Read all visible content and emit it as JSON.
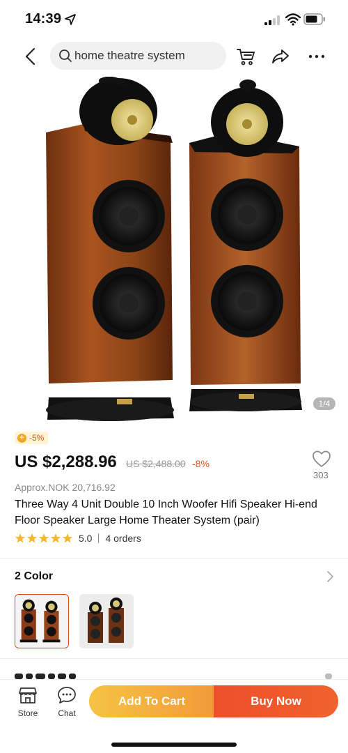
{
  "status_bar": {
    "time": "14:39"
  },
  "nav": {
    "search_text": "home theatre system",
    "icons": [
      "back-chevron-icon",
      "search-icon",
      "cart-icon",
      "share-icon",
      "more-icon"
    ]
  },
  "gallery": {
    "counter": "1/4"
  },
  "price_block": {
    "discount_tag": "-5%",
    "price": "US $2,288.96",
    "original_price": "US $2,488.00",
    "percent_off": "-8%",
    "approx": "Approx.NOK 20,716.92",
    "wishlist_count": "303"
  },
  "product": {
    "title": "Three Way 4 Unit Double 10 Inch Woofer Hifi Speaker Hi-end Floor Speaker Large Home Theater System (pair)",
    "rating": "5.0",
    "stars": 5,
    "orders": "4 orders"
  },
  "color_section": {
    "title": "2 Color",
    "selected_index": 0
  },
  "bottom_bar": {
    "store_label": "Store",
    "chat_label": "Chat",
    "add_to_cart": "Add To Cart",
    "buy_now": "Buy Now"
  },
  "colors": {
    "accent": "#e0541e",
    "add_cart_gradient": [
      "#f6c343",
      "#f29a3a"
    ],
    "buy_now": "#ee4f2a",
    "star": "#f5b82e"
  }
}
